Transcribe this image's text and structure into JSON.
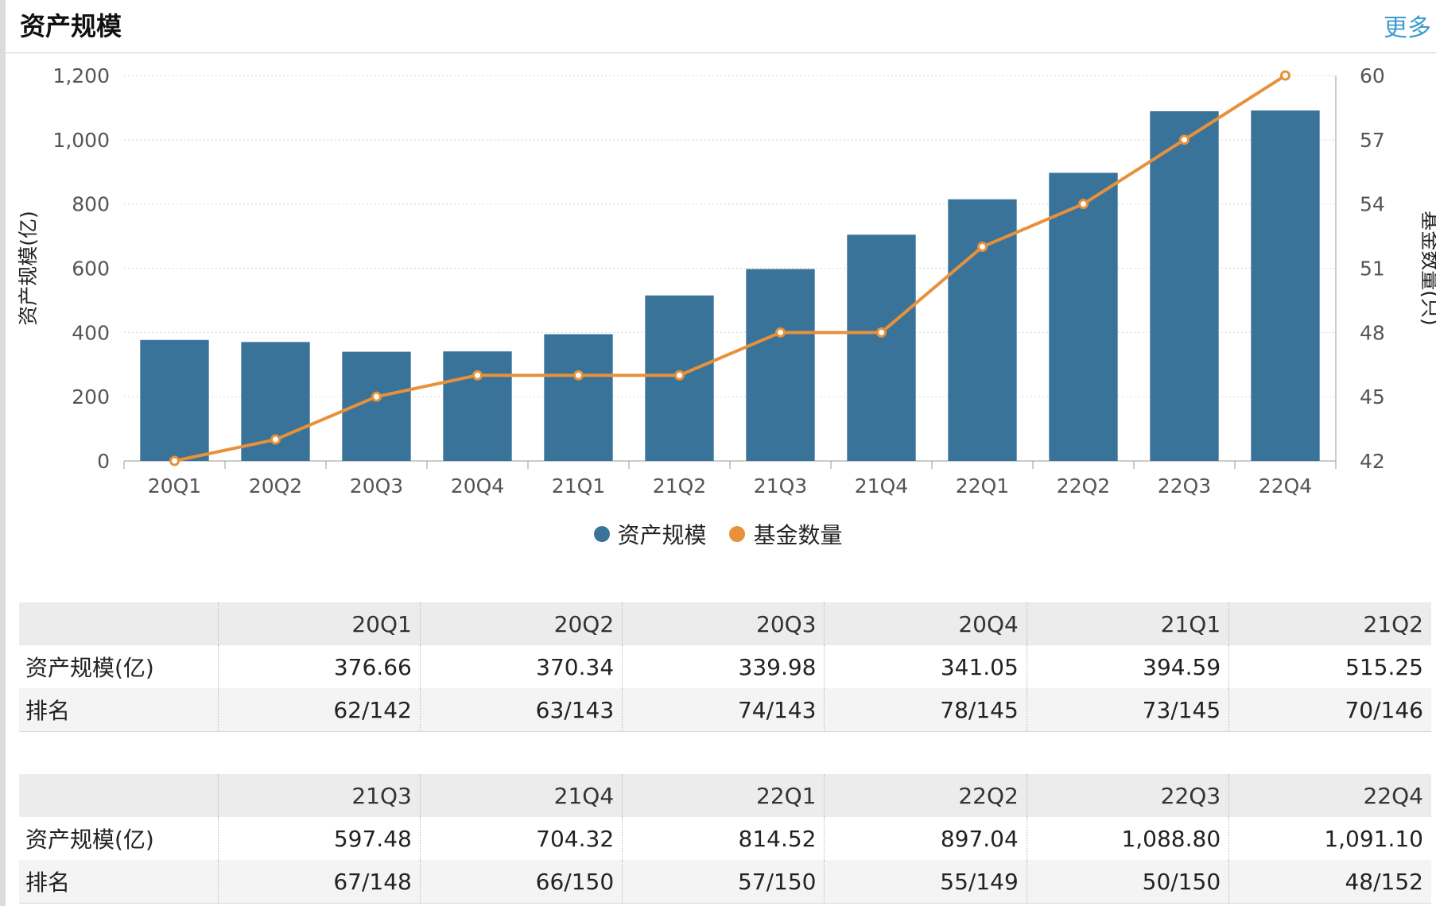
{
  "header": {
    "title": "资产规模",
    "more_label": "更多"
  },
  "legend": {
    "bar_label": "资产规模",
    "line_label": "基金数量"
  },
  "colors": {
    "bar": "#3a7399",
    "line": "#e8913a",
    "more_link": "#3c9bd0"
  },
  "chart_data": {
    "type": "bar",
    "categories": [
      "20Q1",
      "20Q2",
      "20Q3",
      "20Q4",
      "21Q1",
      "21Q2",
      "21Q3",
      "21Q4",
      "22Q1",
      "22Q2",
      "22Q3",
      "22Q4"
    ],
    "series": [
      {
        "name": "资产规模",
        "type": "bar",
        "axis": "left",
        "values": [
          376.66,
          370.34,
          339.98,
          341.05,
          394.59,
          515.25,
          597.48,
          704.32,
          814.52,
          897.04,
          1088.8,
          1091.1
        ]
      },
      {
        "name": "基金数量",
        "type": "line",
        "axis": "right",
        "values": [
          42,
          43,
          45,
          46,
          46,
          46,
          48,
          48,
          52,
          54,
          57,
          60
        ]
      }
    ],
    "ylabel": "资产规模(亿)",
    "y2label": "基金数量(只)",
    "ylim": [
      0,
      1200
    ],
    "y2lim": [
      42,
      60
    ],
    "yticks": [
      "0",
      "200",
      "400",
      "600",
      "800",
      "1,000",
      "1,200"
    ],
    "y2ticks": [
      "42",
      "45",
      "48",
      "51",
      "54",
      "57",
      "60"
    ],
    "legend": "bottom-center",
    "grid": true
  },
  "tables": [
    {
      "columns": [
        "",
        "20Q1",
        "20Q2",
        "20Q3",
        "20Q4",
        "21Q1",
        "21Q2"
      ],
      "rows": [
        [
          "资产规模(亿)",
          "376.66",
          "370.34",
          "339.98",
          "341.05",
          "394.59",
          "515.25"
        ],
        [
          "排名",
          "62/142",
          "63/143",
          "74/143",
          "78/145",
          "73/145",
          "70/146"
        ]
      ]
    },
    {
      "columns": [
        "",
        "21Q3",
        "21Q4",
        "22Q1",
        "22Q2",
        "22Q3",
        "22Q4"
      ],
      "rows": [
        [
          "资产规模(亿)",
          "597.48",
          "704.32",
          "814.52",
          "897.04",
          "1,088.80",
          "1,091.10"
        ],
        [
          "排名",
          "67/148",
          "66/150",
          "57/150",
          "55/149",
          "50/150",
          "48/152"
        ]
      ]
    }
  ]
}
